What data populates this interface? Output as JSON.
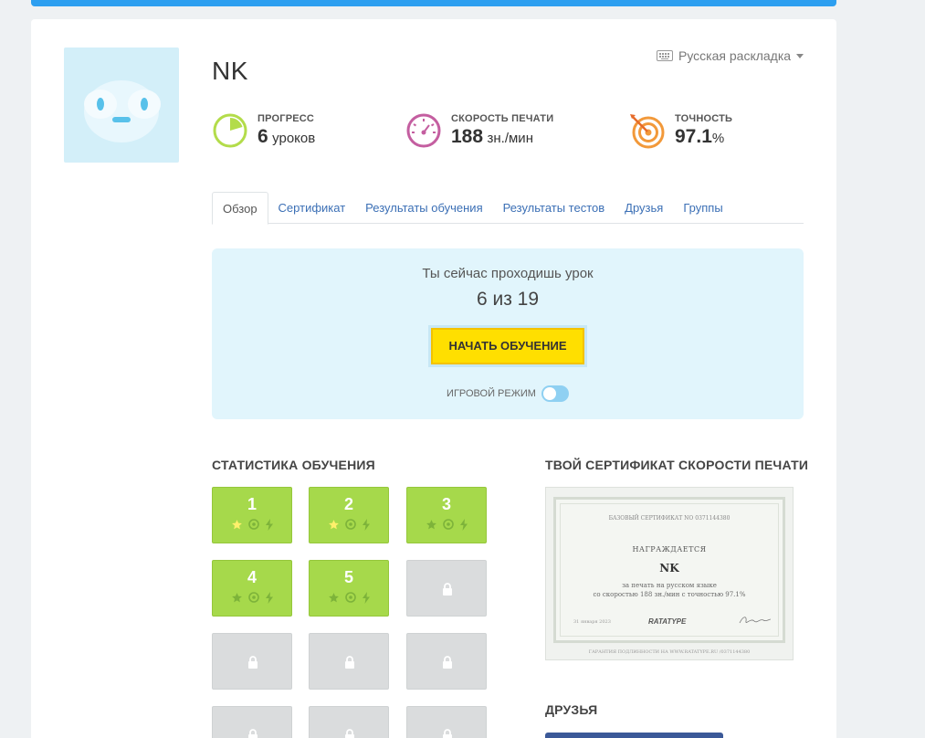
{
  "user": {
    "name": "NK"
  },
  "layout": {
    "label": "Русская раскладка"
  },
  "stats": {
    "progress": {
      "label": "ПРОГРЕСС",
      "value": "6",
      "unit": "уроков"
    },
    "speed": {
      "label": "СКОРОСТЬ ПЕЧАТИ",
      "value": "188",
      "unit": "зн./мин"
    },
    "accuracy": {
      "label": "ТОЧНОСТЬ",
      "value": "97.1",
      "unit": "%"
    }
  },
  "tabs": [
    {
      "label": "Обзор",
      "active": true
    },
    {
      "label": "Сертификат"
    },
    {
      "label": "Результаты обучения"
    },
    {
      "label": "Результаты тестов"
    },
    {
      "label": "Друзья"
    },
    {
      "label": "Группы"
    }
  ],
  "current_lesson": {
    "prompt": "Ты сейчас проходишь урок",
    "value": "6 из 19",
    "button": "НАЧАТЬ ОБУЧЕНИЕ",
    "game_mode_label": "ИГРОВОЙ РЕЖИМ",
    "game_mode_on": false
  },
  "training_stats": {
    "title": "СТАТИСТИКА ОБУЧЕНИЯ",
    "lessons": [
      {
        "number": "1",
        "status": "open",
        "star_earned": true
      },
      {
        "number": "2",
        "status": "open",
        "star_earned": true
      },
      {
        "number": "3",
        "status": "open",
        "star_earned": false
      },
      {
        "number": "4",
        "status": "open",
        "star_earned": false
      },
      {
        "number": "5",
        "status": "open",
        "star_earned": false
      },
      {
        "number": "",
        "status": "locked"
      },
      {
        "number": "",
        "status": "locked"
      },
      {
        "number": "",
        "status": "locked"
      },
      {
        "number": "",
        "status": "locked"
      },
      {
        "number": "",
        "status": "locked"
      },
      {
        "number": "",
        "status": "locked"
      },
      {
        "number": "",
        "status": "locked"
      }
    ]
  },
  "certificate": {
    "title": "ТВОЙ СЕРТИФИКАТ СКОРОСТИ ПЕЧАТИ",
    "heading": "БАЗОВЫЙ СЕРТИФИКАТ NO 0371144380",
    "awarded": "НАГРАЖДАЕТСЯ",
    "name": "NK",
    "line1": "за печать на русском языке",
    "line2": "со скоростью 188 зн./мин с точностью 97.1%",
    "date": "31 января 2023",
    "brand": "RATATYPE",
    "footer": "ГАРАНТИЯ ПОДЛИННОСТИ НА WWW.RATATYPE.RU /0371144380"
  },
  "friends": {
    "title": "ДРУЗЬЯ"
  },
  "colors": {
    "accent": "#2d9ff0",
    "progress": "#b3dc4a",
    "speed": "#c45ea0",
    "accuracy": "#f2993a",
    "tile_open": "#a6d94b",
    "tile_locked": "#dadcdd",
    "button": "#ffdf00"
  }
}
